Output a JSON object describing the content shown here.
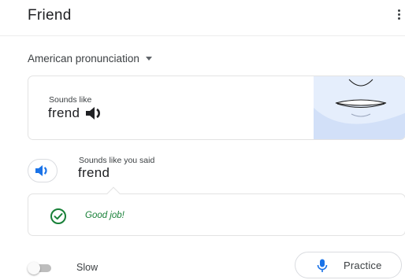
{
  "header": {
    "title": "Friend",
    "menu_icon": "more-vert-icon"
  },
  "accent": {
    "label": "American pronunciation",
    "icon": "caret-down-icon"
  },
  "sounds_like": {
    "label": "Sounds like",
    "word": "frend",
    "speaker_icon": "speaker-icon",
    "illustration": "mouth-illustration"
  },
  "user_said": {
    "label": "Sounds like you said",
    "word": "frend",
    "speaker_icon": "speaker-icon"
  },
  "feedback": {
    "text": "Good job!",
    "icon": "check-circle-icon",
    "color": "#188038"
  },
  "controls": {
    "slow_label": "Slow",
    "slow_enabled": false,
    "practice_label": "Practice",
    "mic_icon": "mic-icon"
  },
  "colors": {
    "accent_blue": "#1a73e8",
    "illustration_bg": "#e5eefc",
    "success_green": "#188038"
  }
}
